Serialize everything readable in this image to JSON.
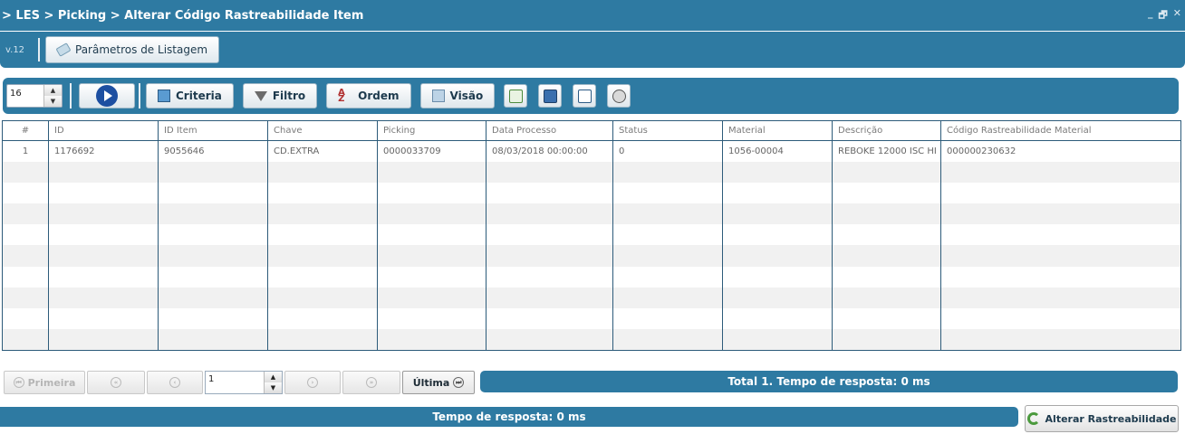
{
  "window": {
    "breadcrumb": "> LES > Picking > Alterar Código Rastreabilidade Item",
    "minimize_glyph": "_",
    "restore_glyph": "🗗",
    "close_glyph": "✕"
  },
  "tabbar": {
    "version": "v.12",
    "tab_label": "Parâmetros de Listagem"
  },
  "toolbar": {
    "page_size": "16",
    "criteria_label": "Criteria",
    "filter_label": "Filtro",
    "order_label": "Ordem",
    "view_label": "Visão"
  },
  "grid": {
    "columns": [
      "#",
      "ID",
      "ID Item",
      "Chave",
      "Picking",
      "Data Processo",
      "Status",
      "Material",
      "Descrição",
      "Código Rastreabilidade Material"
    ],
    "rows": [
      [
        "1",
        "1176692",
        "9055646",
        "CD.EXTRA",
        "0000033709",
        "08/03/2018 00:00:00",
        "0",
        "1056-00004",
        "REBOKE 12000 ISC HI",
        "000000230632"
      ]
    ]
  },
  "pager": {
    "first_label": "Primeira",
    "last_label": "Última",
    "current_page": "1",
    "total_text": "Total 1. Tempo de resposta: 0 ms"
  },
  "footer": {
    "status_text": "Tempo de resposta: 0 ms",
    "action_label": "Alterar Rastreabilidade"
  },
  "colors": {
    "accent": "#2e7aa2",
    "grid_border": "#2d5b7a"
  }
}
